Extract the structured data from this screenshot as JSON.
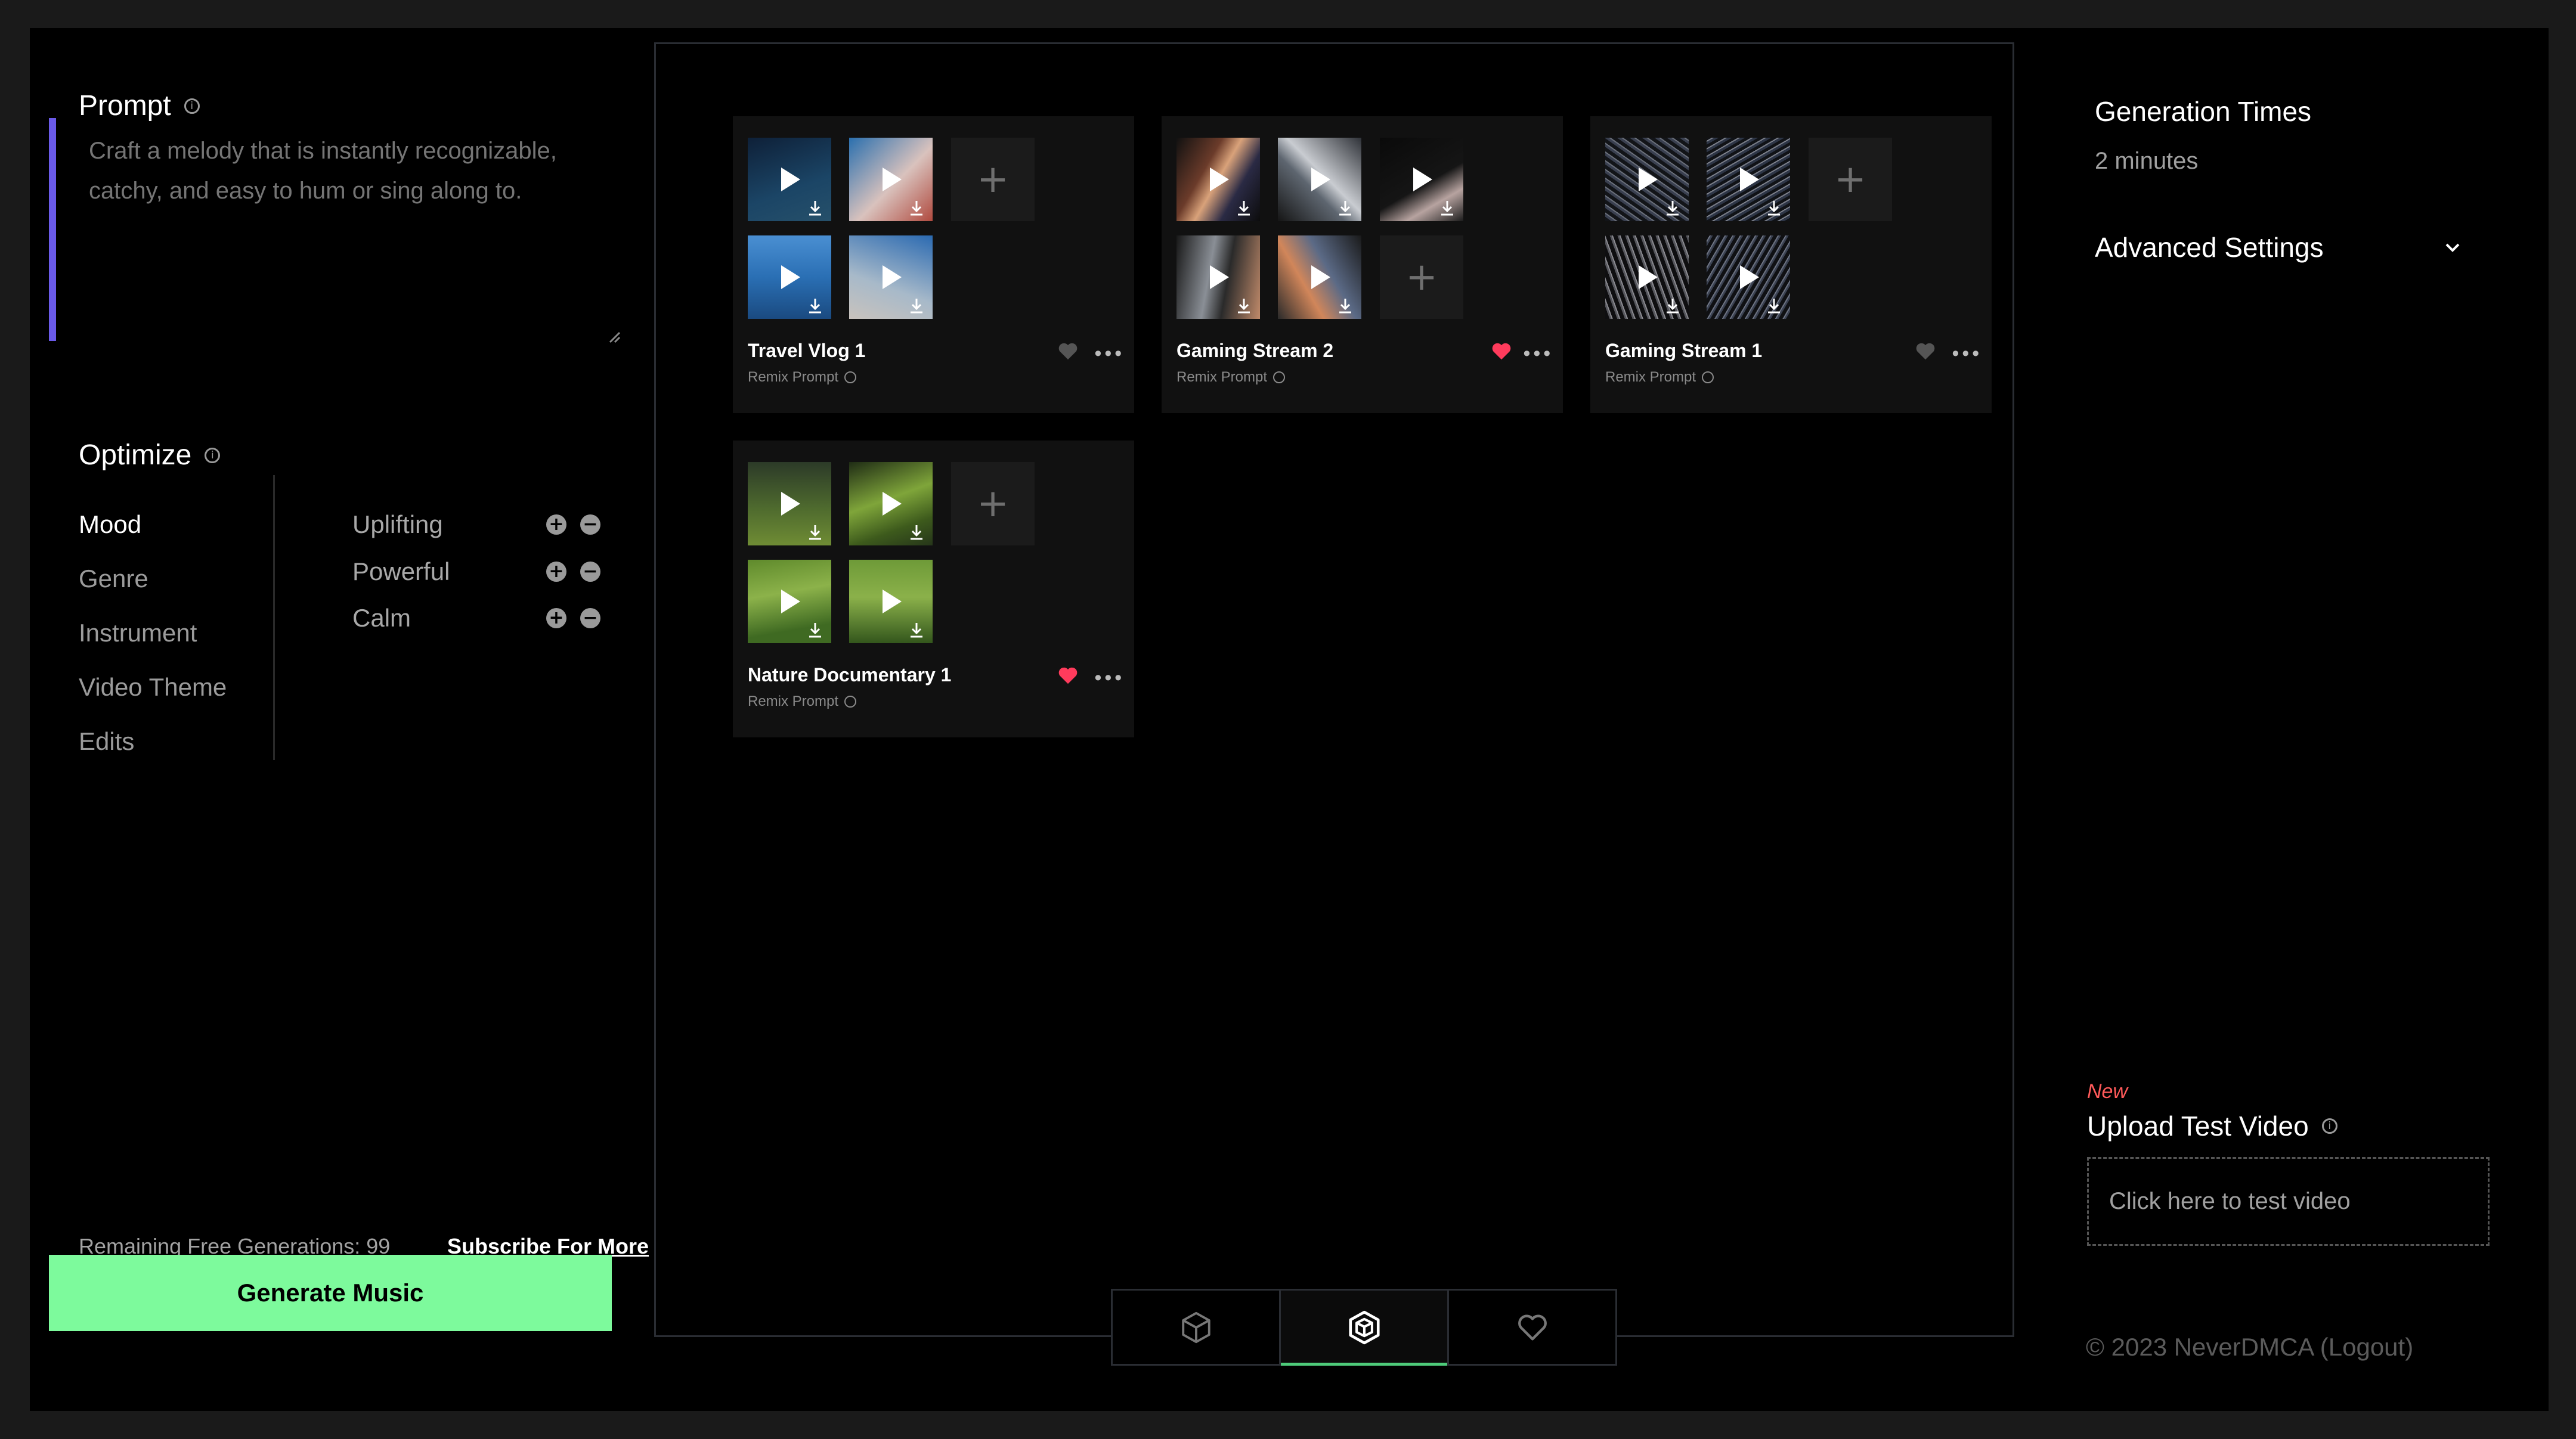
{
  "left": {
    "prompt_title": "Prompt",
    "prompt_placeholder": "Craft a melody that is instantly recognizable, catchy, and easy to hum or sing along to.",
    "optimize_title": "Optimize",
    "categories": [
      "Mood",
      "Genre",
      "Instrument",
      "Video Theme",
      "Edits"
    ],
    "active_category": "Mood",
    "moods": [
      "Uplifting",
      "Powerful",
      "Calm"
    ],
    "remaining": "Remaining Free Generations: 99",
    "subscribe": "Subscribe For More",
    "generate": "Generate Music"
  },
  "cards": [
    {
      "title": "Travel Vlog 1",
      "sub": "Remix Prompt",
      "liked": false
    },
    {
      "title": "Gaming Stream 2",
      "sub": "Remix Prompt",
      "liked": true
    },
    {
      "title": "Gaming Stream 1",
      "sub": "Remix Prompt",
      "liked": false
    },
    {
      "title": "Nature Documentary 1",
      "sub": "Remix Prompt",
      "liked": true
    }
  ],
  "tabs": [
    {
      "icon": "cube-outline-icon",
      "active": false
    },
    {
      "icon": "cube-solid-icon",
      "active": true
    },
    {
      "icon": "heart-outline-icon",
      "active": false
    }
  ],
  "right": {
    "gen_times_title": "Generation Times",
    "gen_times_value": "2 minutes",
    "advanced": "Advanced Settings",
    "new_tag": "New",
    "upload_title": "Upload Test Video",
    "upload_box": "Click here to test video",
    "footer": "© 2023 NeverDMCA (Logout)"
  },
  "colors": {
    "accent_green": "#7dfa9c",
    "prompt_bar": "#6a5ae8",
    "heart_red": "#ff3b5c",
    "new_red": "#ff5a5a"
  }
}
